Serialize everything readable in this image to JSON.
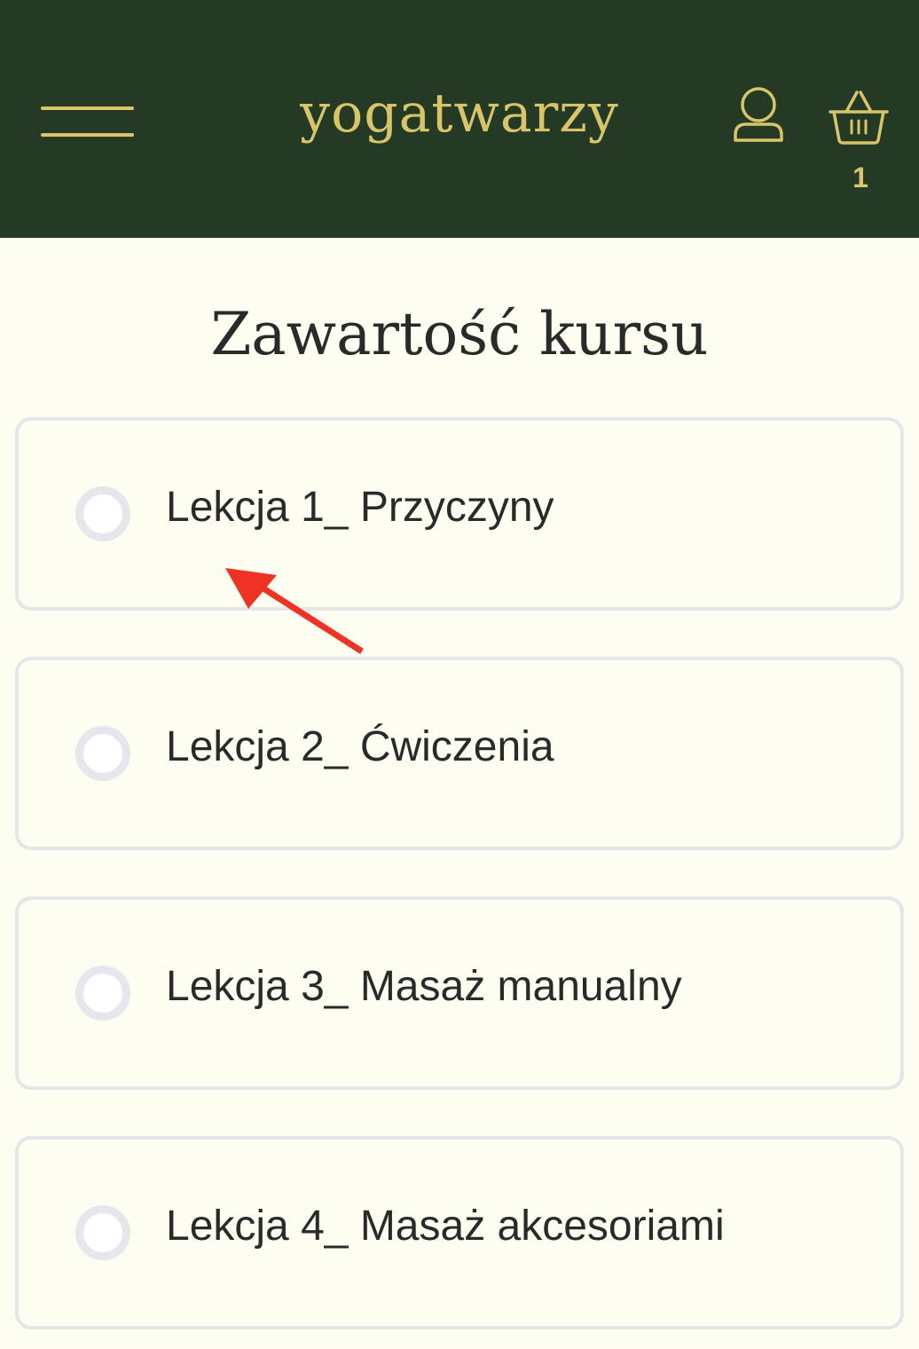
{
  "header": {
    "logo_text": "yogatwarzy",
    "cart_count": "1",
    "icons": {
      "menu": "hamburger-menu-icon",
      "account": "user-icon",
      "cart": "basket-icon"
    },
    "colors": {
      "background": "#243a25",
      "accent": "#d9c46a"
    }
  },
  "main": {
    "title": "Zawartość kursu",
    "lessons": [
      {
        "label": "Lekcja 1_ Przyczyny"
      },
      {
        "label": "Lekcja 2_ Ćwiczenia"
      },
      {
        "label": "Lekcja 3_ Masaż manualny"
      },
      {
        "label": "Lekcja 4_ Masaż akcesoriami"
      }
    ]
  },
  "annotation": {
    "icon": "red-arrow-icon",
    "color": "#ec3324"
  }
}
